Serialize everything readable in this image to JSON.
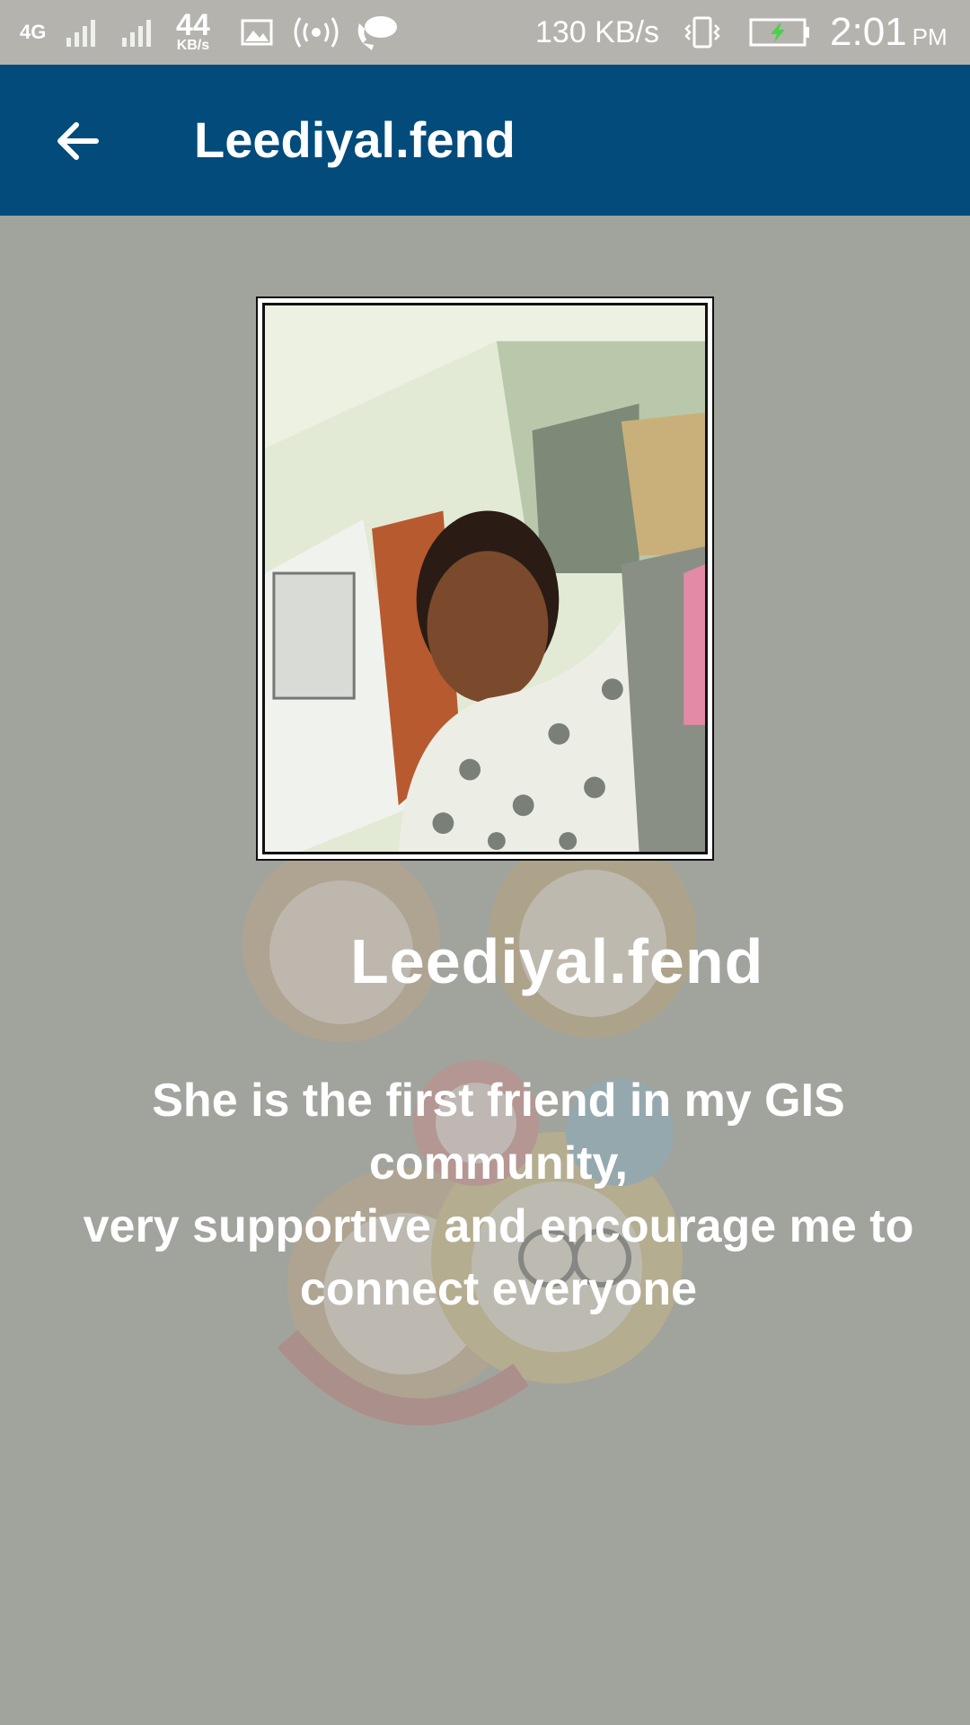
{
  "status_bar": {
    "network": "4G",
    "data_speed_small_value": "44",
    "data_speed_small_unit": "KB/s",
    "data_speed": "130 KB/s",
    "time": "2:01",
    "ampm": "PM",
    "icons": [
      "signal-icon",
      "signal-icon",
      "gallery-icon",
      "hotspot-icon",
      "chat-icon",
      "vibrate-icon",
      "battery-charging-icon"
    ]
  },
  "app_bar": {
    "back_icon": "arrow-left-icon",
    "title": "Leediyal.fend"
  },
  "profile": {
    "name": "Leediyal.fend",
    "description_line1": "She is the first friend in my GIS community,",
    "description_line2": "very supportive and encourage me to connect everyone"
  },
  "colors": {
    "app_bar": "#024b7b",
    "status_bar": "#b4b3ae",
    "background": "#a1a39d",
    "text": "#ffffff"
  }
}
